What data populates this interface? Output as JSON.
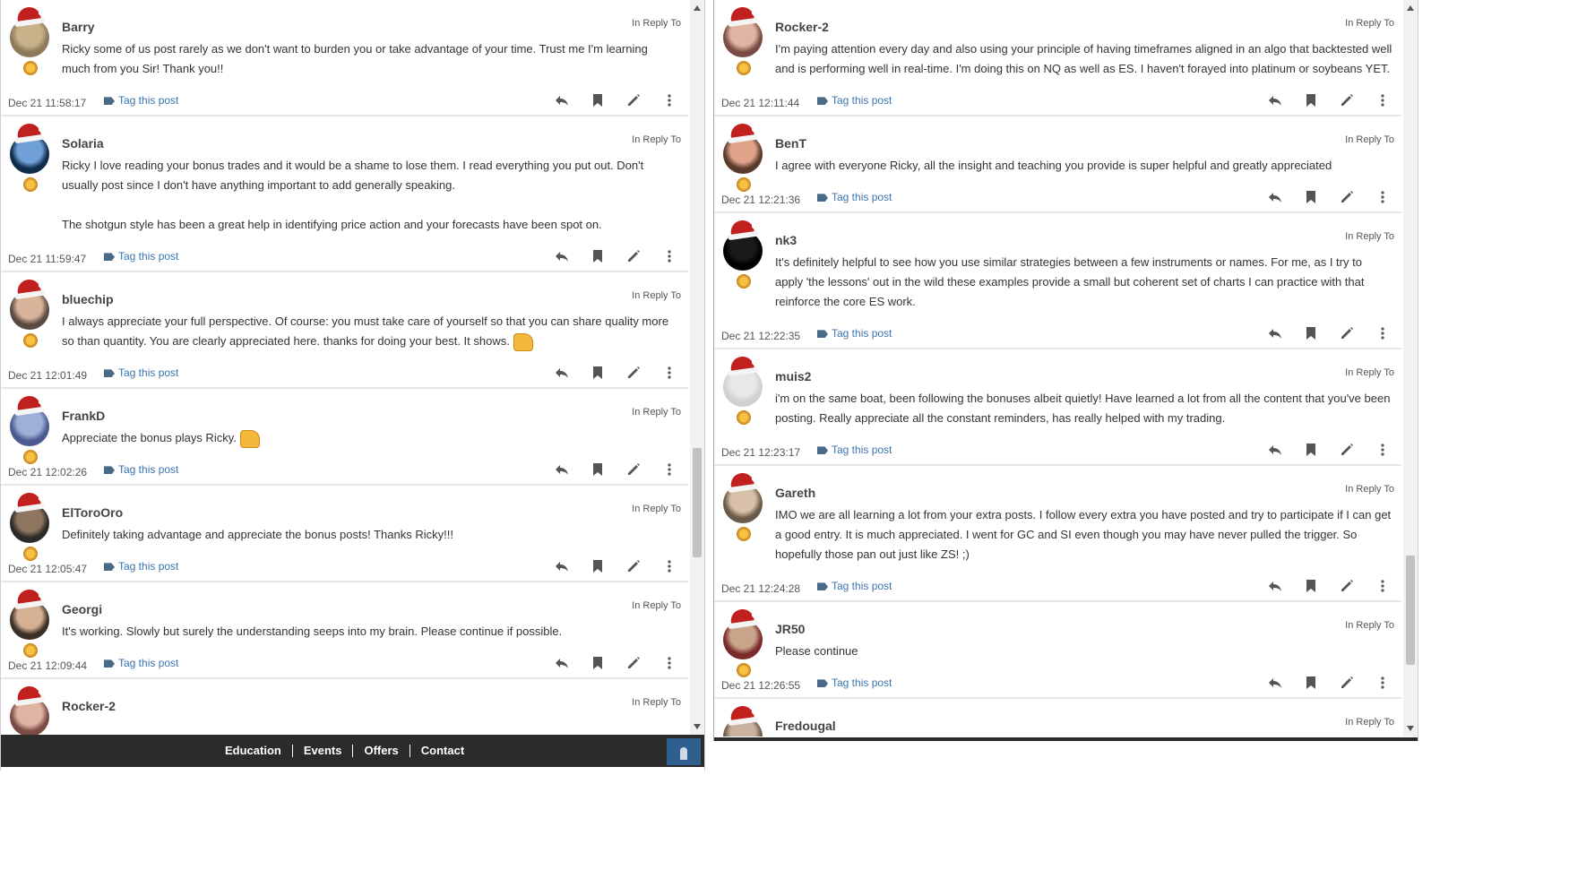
{
  "left": {
    "posts": [
      {
        "author": "Barry",
        "reply": "In Reply To",
        "date": "Dec 21 11:58:17",
        "tag": "Tag this post",
        "c1": "#8d7a5a",
        "c2": "#c9b28a",
        "body": [
          "Ricky some of us post rarely as we don't want to burden you or take advantage of your time. Trust me I'm learning much from you Sir! Thank you!!"
        ]
      },
      {
        "author": "Solaria",
        "reply": "In Reply To",
        "date": "Dec 21 11:59:47",
        "tag": "Tag this post",
        "c1": "#0f2b4c",
        "c2": "#6fa0d8",
        "body": [
          "Ricky I love reading your bonus trades and it would be a shame to lose them. I read everything you put out. Don't usually post since I don't have anything important to add generally speaking.",
          "",
          "The shotgun style has been a great help in identifying price action and your forecasts have been spot on."
        ]
      },
      {
        "author": "bluechip",
        "reply": "In Reply To",
        "date": "Dec 21 12:01:49",
        "tag": "Tag this post",
        "c1": "#5a4a44",
        "c2": "#d9b49a",
        "body": [
          "I always appreciate your full perspective. Of course: you must take care of yourself so that you can share quality more so than quantity. You are clearly appreciated here. thanks for doing your best. It shows."
        ],
        "emoji": true
      },
      {
        "author": "FrankD",
        "reply": "In Reply To",
        "date": "Dec 21 12:02:26",
        "tag": "Tag this post",
        "c1": "#4b5a8f",
        "c2": "#9fb0d8",
        "body": [
          "Appreciate the bonus plays Ricky."
        ],
        "emoji": true
      },
      {
        "author": "ElToroOro",
        "reply": "In Reply To",
        "date": "Dec 21 12:05:47",
        "tag": "Tag this post",
        "c1": "#2c2a28",
        "c2": "#8f7660",
        "body": [
          "Definitely taking advantage and appreciate the bonus posts! Thanks Ricky!!!"
        ]
      },
      {
        "author": "Georgi",
        "reply": "In Reply To",
        "date": "Dec 21 12:09:44",
        "tag": "Tag this post",
        "c1": "#3a3027",
        "c2": "#d6b093",
        "body": [
          "It's working. Slowly but surely the understanding seeps into my brain. Please continue if possible."
        ]
      },
      {
        "author": "Rocker-2",
        "reply": "In Reply To",
        "date": "",
        "tag": "",
        "c1": "#7a4b44",
        "c2": "#e0b4a3",
        "body": []
      }
    ]
  },
  "right": {
    "posts": [
      {
        "author": "Rocker-2",
        "reply": "In Reply To",
        "date": "Dec 21 12:11:44",
        "tag": "Tag this post",
        "c1": "#7a4b44",
        "c2": "#e0b4a3",
        "body": [
          "I'm paying attention every day and also using your principle of having timeframes aligned in an algo that backtested well and is performing well in real-time. I'm doing this on NQ as well as ES. I haven't forayed into platinum or soybeans YET."
        ]
      },
      {
        "author": "BenT",
        "reply": "In Reply To",
        "date": "Dec 21 12:21:36",
        "tag": "Tag this post",
        "c1": "#5a3a2a",
        "c2": "#e0a38a",
        "body": [
          "I agree with everyone Ricky, all the insight and teaching you provide is super helpful and greatly appreciated"
        ]
      },
      {
        "author": "nk3",
        "reply": "In Reply To",
        "date": "Dec 21 12:22:35",
        "tag": "Tag this post",
        "c1": "#000000",
        "c2": "#1a1a1a",
        "body": [
          "It's definitely helpful to see how you use similar strategies between a few instruments or names. For me, as I try to apply 'the lessons' out in the wild these examples provide a small but coherent set of charts I can practice with that reinforce the core ES work."
        ]
      },
      {
        "author": "muis2",
        "reply": "In Reply To",
        "date": "Dec 21 12:23:17",
        "tag": "Tag this post",
        "c1": "#d0d0d0",
        "c2": "#e8e8e8",
        "body": [
          "i'm on the same boat, been following the bonuses albeit quietly! Have learned a lot from all the content that you've been posting. Really appreciate all the constant reminders, has really helped with my trading."
        ]
      },
      {
        "author": "Gareth",
        "reply": "In Reply To",
        "date": "Dec 21 12:24:28",
        "tag": "Tag this post",
        "c1": "#6a5a4a",
        "c2": "#d9c0a8",
        "body": [
          "IMO we are all learning a lot from your extra posts. I follow every extra you have posted and try to participate if I can get a good entry. It is much appreciated. I went for GC and SI even though you may have never pulled the trigger. So hopefully those pan out just like ZS! ;)"
        ]
      },
      {
        "author": "JR50",
        "reply": "In Reply To",
        "date": "Dec 21 12:26:55",
        "tag": "Tag this post",
        "c1": "#7a2a2a",
        "c2": "#c9a48a",
        "body": [
          "Please continue"
        ]
      },
      {
        "author": "Fredougal",
        "reply": "In Reply To",
        "date": "",
        "tag": "",
        "c1": "#6a5a4a",
        "c2": "#c9b2a0",
        "body": []
      }
    ]
  },
  "bottombar": {
    "links": [
      "Education",
      "Events",
      "Offers",
      "Contact"
    ]
  }
}
